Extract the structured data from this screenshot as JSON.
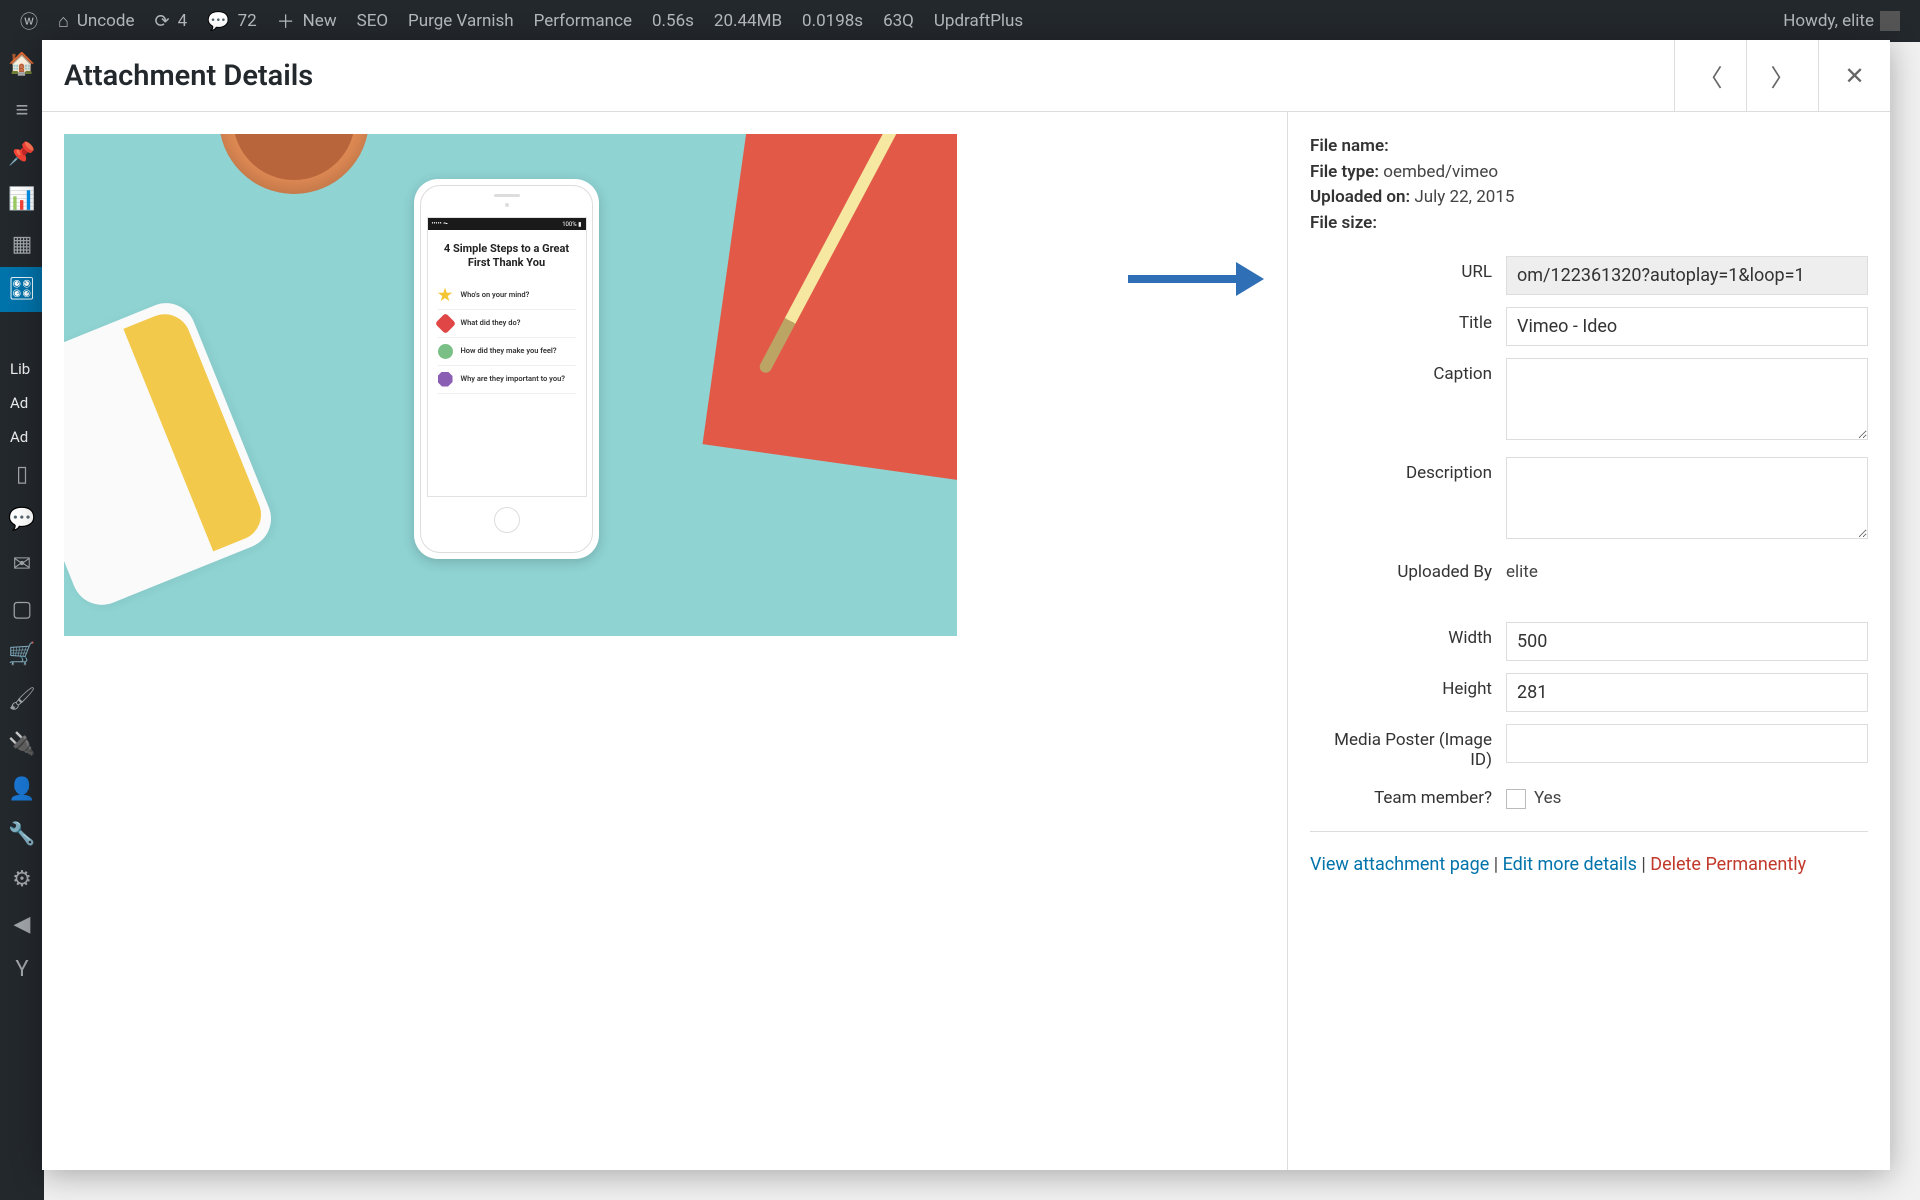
{
  "adminbar": {
    "site_name": "Uncode",
    "updates": "4",
    "comments": "72",
    "new_label": "New",
    "items": [
      "SEO",
      "Purge Varnish",
      "Performance",
      "0.56s",
      "20.44MB",
      "0.0198s",
      "63Q",
      "UpdraftPlus"
    ],
    "howdy": "Howdy, elite"
  },
  "sidebar_submenu": [
    "Lib",
    "Ad",
    "Ad"
  ],
  "modal": {
    "title": "Attachment Details"
  },
  "preview": {
    "heading": "4 Simple Steps to a Great First Thank You",
    "steps": [
      "Who's on your mind?",
      "What did they do?",
      "How did they make you feel?",
      "Why are they important to you?"
    ],
    "status_left": "•••••  ⏦",
    "status_right": "100% ▮"
  },
  "meta": {
    "filename_label": "File name:",
    "filename_value": "",
    "filetype_label": "File type:",
    "filetype_value": "oembed/vimeo",
    "uploaded_label": "Uploaded on:",
    "uploaded_value": "July 22, 2015",
    "filesize_label": "File size:",
    "filesize_value": ""
  },
  "fields": {
    "url_label": "URL",
    "url_value": "om/122361320?autoplay=1&loop=1",
    "title_label": "Title",
    "title_value": "Vimeo - Ideo",
    "caption_label": "Caption",
    "caption_value": "",
    "description_label": "Description",
    "description_value": "",
    "uploadedby_label": "Uploaded By",
    "uploadedby_value": "elite",
    "width_label": "Width",
    "width_value": "500",
    "height_label": "Height",
    "height_value": "281",
    "poster_label": "Media Poster (Image ID)",
    "poster_value": "",
    "team_label": "Team member?",
    "team_option": "Yes"
  },
  "links": {
    "view": "View attachment page",
    "edit": "Edit more details",
    "delete": "Delete Permanently",
    "sep": " | "
  }
}
